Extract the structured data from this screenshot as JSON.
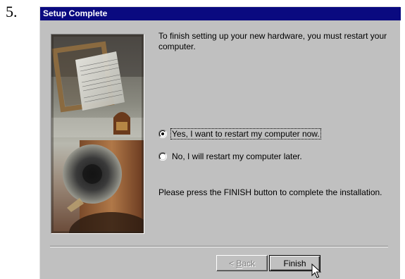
{
  "step": {
    "number": "5."
  },
  "dialog": {
    "title": "Setup Complete",
    "intro_text": "To finish setting up your new hardware, you must restart your computer.",
    "options": [
      {
        "label": "Yes, I want to restart my computer now.",
        "selected": true
      },
      {
        "label": "No, I will restart my computer later.",
        "selected": false
      }
    ],
    "final_text": "Please press the FINISH button to complete the installation.",
    "buttons": {
      "back": {
        "prefix": "< ",
        "accelerator": "B",
        "rest": "ack",
        "enabled": false
      },
      "finish": {
        "label": "Finish",
        "enabled": true
      }
    }
  },
  "colors": {
    "title_bar": "#0a0a80",
    "dialog_face": "#c0c0c0"
  },
  "icons": {
    "cursor": "arrow-cursor-icon",
    "radio": "radio-button-icon"
  }
}
